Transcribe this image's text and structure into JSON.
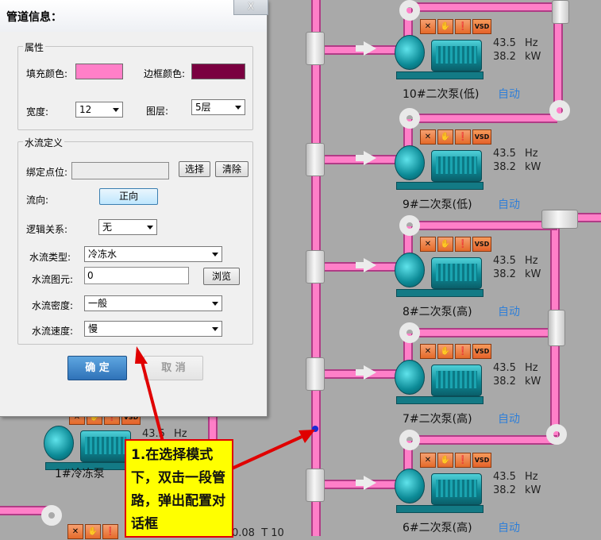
{
  "dialog": {
    "title": "管道信息：",
    "close_label": "X",
    "attributes": {
      "group_title": "属性",
      "fill_color_label": "填充颜色:",
      "fill_color": "#ff7fc8",
      "border_color_label": "边框颜色:",
      "border_color": "#7a0040",
      "width_label": "宽度:",
      "width_value": "12",
      "layer_label": "图层:",
      "layer_value": "5层"
    },
    "water_flow": {
      "group_title": "水流定义",
      "bind_point_label": "绑定点位:",
      "bind_point_value": "",
      "select_button": "选择",
      "clear_button": "清除",
      "direction_label": "流向:",
      "direction_button": "正向",
      "logic_label": "逻辑关系:",
      "logic_value": "无",
      "type_label": "水流类型:",
      "type_value": "冷冻水",
      "element_label": "水流图元:",
      "element_value": "0",
      "browse_button": "浏览",
      "density_label": "水流密度:",
      "density_value": "一般",
      "speed_label": "水流速度:",
      "speed_value": "慢"
    },
    "ok_button": "确 定",
    "cancel_button": "取 消"
  },
  "callout": {
    "text": "1.在选择模式下，双击一段管路，弹出配置对话框",
    "color": "#e00000"
  },
  "pumps": [
    {
      "name": "10#二次泵(低)",
      "mode": "自动",
      "hz": "43.5",
      "hz_unit": "Hz",
      "kw": "38.2",
      "kw_unit": "kW"
    },
    {
      "name": "9#二次泵(低)",
      "mode": "自动",
      "hz": "43.5",
      "hz_unit": "Hz",
      "kw": "38.2",
      "kw_unit": "kW"
    },
    {
      "name": "8#二次泵(高)",
      "mode": "自动",
      "hz": "43.5",
      "hz_unit": "Hz",
      "kw": "38.2",
      "kw_unit": "kW"
    },
    {
      "name": "7#二次泵(高)",
      "mode": "自动",
      "hz": "43.5",
      "hz_unit": "Hz",
      "kw": "38.2",
      "kw_unit": "kW"
    },
    {
      "name": "6#二次泵(高)",
      "mode": "自动",
      "hz": "43.5",
      "hz_unit": "Hz",
      "kw": "38.2",
      "kw_unit": "kW"
    }
  ],
  "chiller_pump": {
    "name": "1#冷冻泵",
    "hz": "43.5",
    "hz_unit": "Hz"
  },
  "pump_icons": {
    "stop": "✕",
    "hand": "✋",
    "alarm": "❗",
    "vsd": "VSD"
  },
  "bottom_partial": "0.08  T 10"
}
